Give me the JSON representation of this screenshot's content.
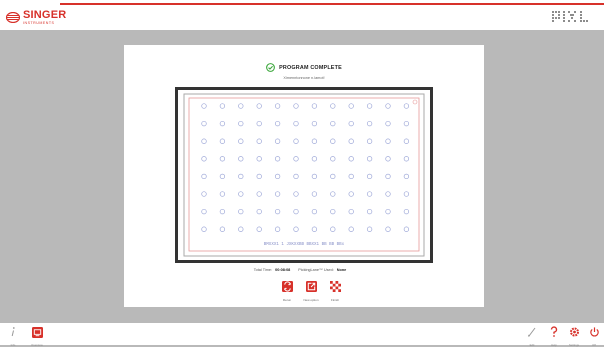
{
  "header": {
    "brand_name": "SINGER",
    "brand_sub": "INSTRUMENTS",
    "product_logo_text": "PIXL"
  },
  "status": {
    "title": "PROGRAM COMPLETE",
    "subtitle": "Ximenntonnone n.lamot!"
  },
  "plate": {
    "rows": 8,
    "cols": 12,
    "barcode_text": "BMXXX1   1   JXKXXBB  BBXX1       BB   BB  BBx"
  },
  "info": {
    "total_time_label": "Total Time:",
    "total_time_value": "00:08:08",
    "pickinglane_label": "PickingLane™ Used:",
    "pickinglane_value": "None"
  },
  "actions": [
    {
      "label": "Rerun",
      "icon": "rerun-icon"
    },
    {
      "label": "New option",
      "icon": "new-option-icon"
    },
    {
      "label": "Finish",
      "icon": "finish-icon"
    }
  ],
  "bottom": {
    "left": [
      {
        "label": "Info",
        "icon": "info-icon"
      },
      {
        "label": "Overview",
        "icon": "overview-icon"
      }
    ],
    "right": [
      {
        "label": "Edit",
        "icon": "edit-icon"
      },
      {
        "label": "Help",
        "icon": "help-icon"
      },
      {
        "label": "Settings",
        "icon": "settings-icon"
      },
      {
        "label": "Off",
        "icon": "power-icon"
      }
    ]
  },
  "colors": {
    "accent": "#d7312a",
    "success": "#3aa63a",
    "well": "#9ea8d8",
    "background": "#b9b9b9"
  }
}
